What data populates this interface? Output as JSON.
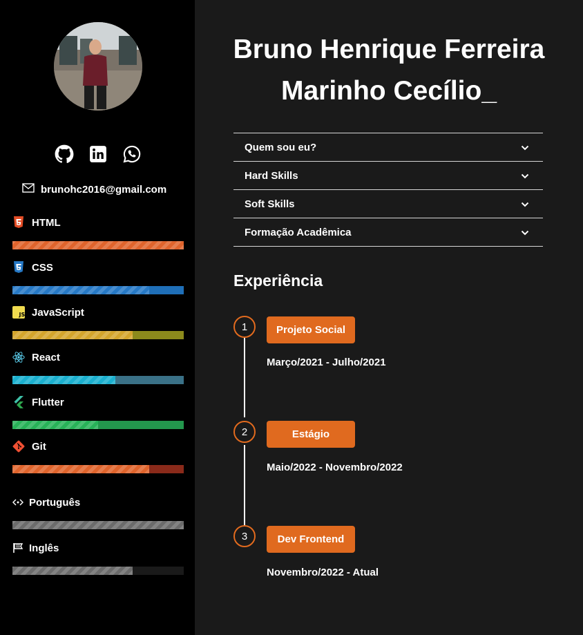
{
  "profile": {
    "name_line1": "Bruno Henrique Ferreira",
    "name_line2": "Marinho Cecílio_",
    "email": "brunohc2016@gmail.com"
  },
  "social_icons": [
    "github-icon",
    "linkedin-icon",
    "whatsapp-icon"
  ],
  "skills": [
    {
      "name": "HTML",
      "level": 1.0,
      "color": "#e0642c",
      "track": "#e0642c",
      "icon": "html5-icon"
    },
    {
      "name": "CSS",
      "level": 0.8,
      "color": "#2679c6",
      "track": "#1f6fb8",
      "icon": "css3-icon"
    },
    {
      "name": "JavaScript",
      "level": 0.7,
      "color": "#d4a52c",
      "track": "#8c8a1c",
      "icon": "javascript-icon"
    },
    {
      "name": "React",
      "level": 0.6,
      "color": "#1ab0cf",
      "track": "#3a7187",
      "icon": "react-icon"
    },
    {
      "name": "Flutter",
      "level": 0.5,
      "color": "#27b258",
      "track": "#23974d",
      "icon": "flutter-icon"
    },
    {
      "name": "Git",
      "level": 0.8,
      "color": "#e0642c",
      "track": "#8a2a1a",
      "icon": "git-icon"
    }
  ],
  "languages": [
    {
      "name": "Português",
      "level": 1.0,
      "color": "#6b6b6b",
      "track": "#6b6b6b",
      "icon": "eye-code-icon"
    },
    {
      "name": "Inglês",
      "level": 0.7,
      "color": "#6b6b6b",
      "track": "#1a1a1a",
      "icon": "flag-icon"
    }
  ],
  "accordion": [
    "Quem sou eu?",
    "Hard Skills",
    "Soft Skills",
    "Formação Acadêmica"
  ],
  "experience": {
    "title": "Experiência",
    "items": [
      {
        "number": "1",
        "label": "Projeto Social",
        "period": "Março/2021 - Julho/2021"
      },
      {
        "number": "2",
        "label": "Estágio",
        "period": "Maio/2022 - Novembro/2022"
      },
      {
        "number": "3",
        "label": "Dev Frontend",
        "period": "Novembro/2022 - Atual"
      }
    ]
  },
  "colors": {
    "accent": "#e06a1f",
    "sidebar": "#000000",
    "main": "#1a1a1a"
  }
}
